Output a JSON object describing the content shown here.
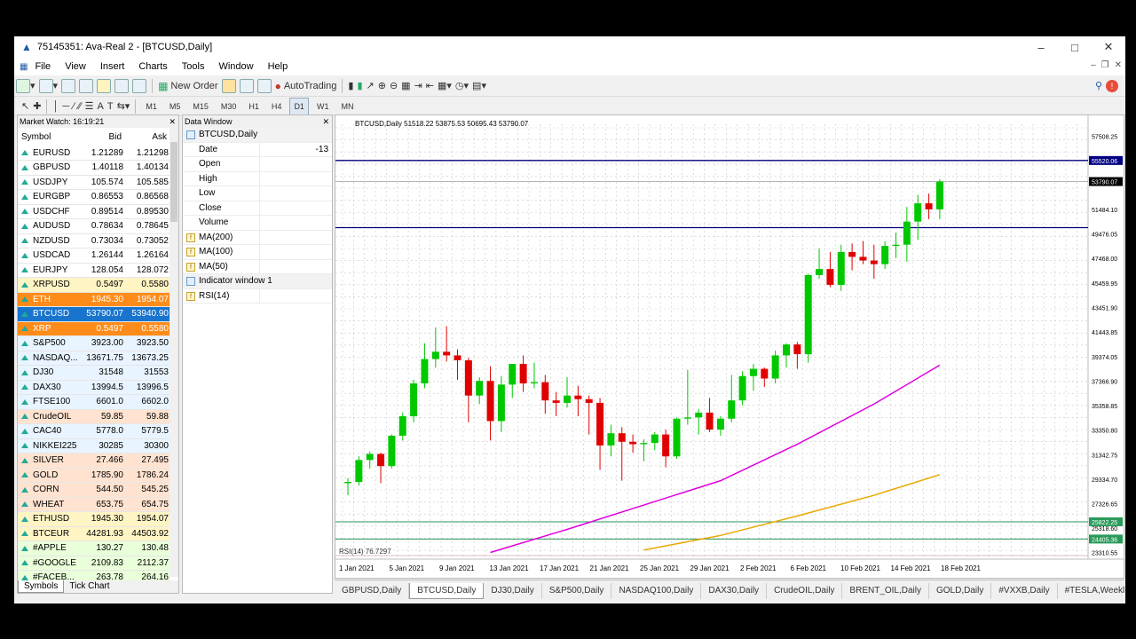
{
  "window": {
    "title": "75145351: Ava-Real 2 - [BTCUSD,Daily]"
  },
  "menu": [
    "File",
    "View",
    "Insert",
    "Charts",
    "Tools",
    "Window",
    "Help"
  ],
  "toolbar": {
    "new_order": "New Order",
    "autotrading": "AutoTrading"
  },
  "timeframes": [
    "M1",
    "M5",
    "M15",
    "M30",
    "H1",
    "H4",
    "D1",
    "W1",
    "MN"
  ],
  "active_timeframe": "D1",
  "market_watch": {
    "header": "Market Watch: 16:19:21",
    "columns": [
      "Symbol",
      "Bid",
      "Ask"
    ],
    "rows": [
      {
        "symbol": "EURUSD",
        "bid": "1.21289",
        "ask": "1.21298",
        "bg": "#ffffff",
        "bg2": "#ffffff"
      },
      {
        "symbol": "GBPUSD",
        "bid": "1.40118",
        "ask": "1.40134",
        "bg": "#ffffff",
        "bg2": "#ffffff"
      },
      {
        "symbol": "USDJPY",
        "bid": "105.574",
        "ask": "105.585",
        "bg": "#ffffff",
        "bg2": "#ffffff"
      },
      {
        "symbol": "EURGBP",
        "bid": "0.86553",
        "ask": "0.86568",
        "bg": "#ffffff",
        "bg2": "#ffffff"
      },
      {
        "symbol": "USDCHF",
        "bid": "0.89514",
        "ask": "0.89530",
        "bg": "#ffffff",
        "bg2": "#ffffff"
      },
      {
        "symbol": "AUDUSD",
        "bid": "0.78634",
        "ask": "0.78645",
        "bg": "#ffffff",
        "bg2": "#ffffff"
      },
      {
        "symbol": "NZDUSD",
        "bid": "0.73034",
        "ask": "0.73052",
        "bg": "#ffffff",
        "bg2": "#ffffff"
      },
      {
        "symbol": "USDCAD",
        "bid": "1.26144",
        "ask": "1.26164",
        "bg": "#ffffff",
        "bg2": "#ffffff"
      },
      {
        "symbol": "EURJPY",
        "bid": "128.054",
        "ask": "128.072",
        "bg": "#ffffff",
        "bg2": "#ffffff"
      },
      {
        "symbol": "XRPUSD",
        "bid": "0.5497",
        "ask": "0.5580",
        "bg": "#fff4c4",
        "bg2": "#fff4c4"
      },
      {
        "symbol": "ETH",
        "bid": "1945.30",
        "ask": "1954.07",
        "bg": "#ff8c1a",
        "bg2": "#ff8c1a",
        "fg": "#ffffff"
      },
      {
        "symbol": "BTCUSD",
        "bid": "53790.07",
        "ask": "53940.90",
        "bg": "#1874cd",
        "bg2": "#1874cd",
        "fg": "#ffffff"
      },
      {
        "symbol": "XRP",
        "bid": "0.5497",
        "ask": "0.5580",
        "bg": "#ff8c1a",
        "bg2": "#ff8c1a",
        "fg": "#ffffff"
      },
      {
        "symbol": "S&P500",
        "bid": "3923.00",
        "ask": "3923.50",
        "bg": "#e8f4ff",
        "bg2": "#e8f4ff"
      },
      {
        "symbol": "NASDAQ...",
        "bid": "13671.75",
        "ask": "13673.25",
        "bg": "#e8f4ff",
        "bg2": "#e8f4ff"
      },
      {
        "symbol": "DJ30",
        "bid": "31548",
        "ask": "31553",
        "bg": "#e8f4ff",
        "bg2": "#e8f4ff"
      },
      {
        "symbol": "DAX30",
        "bid": "13994.5",
        "ask": "13996.5",
        "bg": "#e8f4ff",
        "bg2": "#e8f4ff"
      },
      {
        "symbol": "FTSE100",
        "bid": "6601.0",
        "ask": "6602.0",
        "bg": "#e8f4ff",
        "bg2": "#e8f4ff"
      },
      {
        "symbol": "CrudeOIL",
        "bid": "59.85",
        "ask": "59.88",
        "bg": "#ffe3d0",
        "bg2": "#ffe3d0"
      },
      {
        "symbol": "CAC40",
        "bid": "5778.0",
        "ask": "5779.5",
        "bg": "#e8f4ff",
        "bg2": "#e8f4ff"
      },
      {
        "symbol": "NIKKEI225",
        "bid": "30285",
        "ask": "30300",
        "bg": "#e8f4ff",
        "bg2": "#e8f4ff"
      },
      {
        "symbol": "SILVER",
        "bid": "27.466",
        "ask": "27.495",
        "bg": "#ffe3d0",
        "bg2": "#ffe3d0"
      },
      {
        "symbol": "GOLD",
        "bid": "1785.90",
        "ask": "1786.24",
        "bg": "#ffe3d0",
        "bg2": "#ffe3d0"
      },
      {
        "symbol": "CORN",
        "bid": "544.50",
        "ask": "545.25",
        "bg": "#ffe3d0",
        "bg2": "#ffe3d0"
      },
      {
        "symbol": "WHEAT",
        "bid": "653.75",
        "ask": "654.75",
        "bg": "#ffe3d0",
        "bg2": "#ffe3d0"
      },
      {
        "symbol": "ETHUSD",
        "bid": "1945.30",
        "ask": "1954.07",
        "bg": "#fff4c4",
        "bg2": "#fff4c4"
      },
      {
        "symbol": "BTCEUR",
        "bid": "44281.93",
        "ask": "44503.92",
        "bg": "#fff4c4",
        "bg2": "#fff4c4"
      },
      {
        "symbol": "#APPLE",
        "bid": "130.27",
        "ask": "130.48",
        "bg": "#e9ffd9",
        "bg2": "#e9ffd9"
      },
      {
        "symbol": "#GOOGLE",
        "bid": "2109.83",
        "ask": "2112.37",
        "bg": "#e9ffd9",
        "bg2": "#e9ffd9"
      },
      {
        "symbol": "#FACEB...",
        "bid": "263.78",
        "ask": "264.16",
        "bg": "#e9ffd9",
        "bg2": "#e9ffd9"
      }
    ],
    "tabs": [
      "Symbols",
      "Tick Chart"
    ]
  },
  "data_window": {
    "header": "Data Window",
    "symbol": "BTCUSD,Daily",
    "rows": [
      {
        "label": "Date",
        "value": "-13"
      },
      {
        "label": "Open",
        "value": ""
      },
      {
        "label": "High",
        "value": ""
      },
      {
        "label": "Low",
        "value": ""
      },
      {
        "label": "Close",
        "value": ""
      },
      {
        "label": "Volume",
        "value": ""
      }
    ],
    "indicators": [
      "MA(200)",
      "MA(100)",
      "MA(50)"
    ],
    "indicator_window": "Indicator window 1",
    "rsi": "RSI(14)"
  },
  "chart": {
    "info": "BTCUSD,Daily  51518.22 53875.53 50695.43 53790.07",
    "rsi_label": "RSI(14) 76.7297",
    "price_labels": [
      "57508.25",
      "55520.06",
      "53790.07",
      "51484.10",
      "49476.05",
      "47468.00",
      "45459.95",
      "43451.90",
      "41443.85",
      "39374.05",
      "37366.90",
      "35358.85",
      "33350.80",
      "31342.75",
      "29334.70",
      "27326.65",
      "25822.25",
      "25318.60",
      "24405.36",
      "23310.55"
    ],
    "date_labels": [
      "1 Jan 2021",
      "5 Jan 2021",
      "9 Jan 2021",
      "13 Jan 2021",
      "17 Jan 2021",
      "21 Jan 2021",
      "25 Jan 2021",
      "29 Jan 2021",
      "2 Feb 2021",
      "6 Feb 2021",
      "10 Feb 2021",
      "14 Feb 2021",
      "18 Feb 2021"
    ],
    "level_labels": [
      "55520.06",
      "53790.07",
      "50000.00",
      "25822.25",
      "24405.36"
    ],
    "ylim": [
      22900,
      58500
    ],
    "candles": [
      [
        29000,
        29400,
        28000,
        29100
      ],
      [
        29100,
        31200,
        28800,
        30900
      ],
      [
        30900,
        31600,
        30200,
        31400
      ],
      [
        31400,
        31500,
        29000,
        30400
      ],
      [
        30400,
        33000,
        30200,
        32900
      ],
      [
        32900,
        34800,
        32500,
        34500
      ],
      [
        34500,
        37500,
        34000,
        37200
      ],
      [
        37200,
        40500,
        36800,
        39200
      ],
      [
        39200,
        41800,
        38500,
        39800
      ],
      [
        39800,
        41900,
        39000,
        39500
      ],
      [
        39500,
        40000,
        37500,
        39100
      ],
      [
        39100,
        39300,
        34000,
        36200
      ],
      [
        36200,
        37700,
        35500,
        37400
      ],
      [
        37400,
        38600,
        32500,
        34100
      ],
      [
        34100,
        37800,
        33200,
        37100
      ],
      [
        37100,
        38800,
        36000,
        38800
      ],
      [
        38800,
        39500,
        36500,
        37200
      ],
      [
        37200,
        38900,
        36800,
        37300
      ],
      [
        37300,
        37900,
        34700,
        35800
      ],
      [
        35800,
        36500,
        34500,
        35600
      ],
      [
        35600,
        37700,
        35200,
        36200
      ],
      [
        36200,
        37000,
        34500,
        35900
      ],
      [
        35900,
        36200,
        33000,
        35600
      ],
      [
        35600,
        36000,
        30100,
        32100
      ],
      [
        32100,
        33800,
        31200,
        33100
      ],
      [
        33100,
        33600,
        29200,
        32400
      ],
      [
        32400,
        33000,
        31500,
        32200
      ],
      [
        32200,
        32600,
        30800,
        32300
      ],
      [
        32300,
        33200,
        31700,
        33000
      ],
      [
        33000,
        33400,
        30300,
        31200
      ],
      [
        31200,
        34400,
        31000,
        34300
      ],
      [
        34300,
        38300,
        33800,
        34400
      ],
      [
        34400,
        35100,
        33000,
        34800
      ],
      [
        34800,
        36000,
        33200,
        33400
      ],
      [
        33400,
        34500,
        32900,
        34300
      ],
      [
        34300,
        37900,
        34000,
        35800
      ],
      [
        35800,
        38200,
        35400,
        37800
      ],
      [
        37800,
        38800,
        36600,
        38400
      ],
      [
        38400,
        38500,
        36900,
        37600
      ],
      [
        37600,
        39900,
        37200,
        39500
      ],
      [
        39500,
        40500,
        38500,
        40400
      ],
      [
        40400,
        40600,
        38400,
        39600
      ],
      [
        39600,
        46200,
        38900,
        46100
      ],
      [
        46100,
        48300,
        45800,
        46600
      ],
      [
        46600,
        48000,
        45100,
        45300
      ],
      [
        45300,
        48600,
        44800,
        48000
      ],
      [
        48000,
        48700,
        46500,
        47600
      ],
      [
        47600,
        48900,
        47000,
        47300
      ],
      [
        47300,
        48600,
        45800,
        47000
      ],
      [
        47000,
        48900,
        46600,
        48500
      ],
      [
        48500,
        49600,
        47500,
        48600
      ],
      [
        48600,
        51700,
        47200,
        50500
      ],
      [
        50500,
        52700,
        49000,
        52000
      ],
      [
        52000,
        52800,
        50700,
        51500
      ],
      [
        51500,
        54000,
        50700,
        53790
      ]
    ],
    "ma_magenta": [
      [
        13,
        23300
      ],
      [
        20,
        25200
      ],
      [
        27,
        27200
      ],
      [
        34,
        29200
      ],
      [
        41,
        32200
      ],
      [
        48,
        35500
      ],
      [
        54,
        38700
      ]
    ],
    "ma_orange": [
      [
        27,
        23500
      ],
      [
        34,
        24700
      ],
      [
        41,
        26300
      ],
      [
        48,
        28000
      ],
      [
        54,
        29700
      ]
    ]
  },
  "chart_tabs": [
    "GBPUSD,Daily",
    "BTCUSD,Daily",
    "DJ30,Daily",
    "S&P500,Daily",
    "NASDAQ100,Daily",
    "DAX30,Daily",
    "CrudeOIL,Daily",
    "BRENT_OIL,Daily",
    "GOLD,Daily",
    "#VXXB,Daily",
    "#TESLA,Weekl"
  ],
  "active_chart_tab": "BTCUSD,Daily",
  "colors": {
    "bull": "#00c800",
    "bear": "#e00000",
    "hline": "#000080",
    "ma1": "#e000e0",
    "ma2": "#e8a800",
    "green_level": "#2a9a5a"
  }
}
